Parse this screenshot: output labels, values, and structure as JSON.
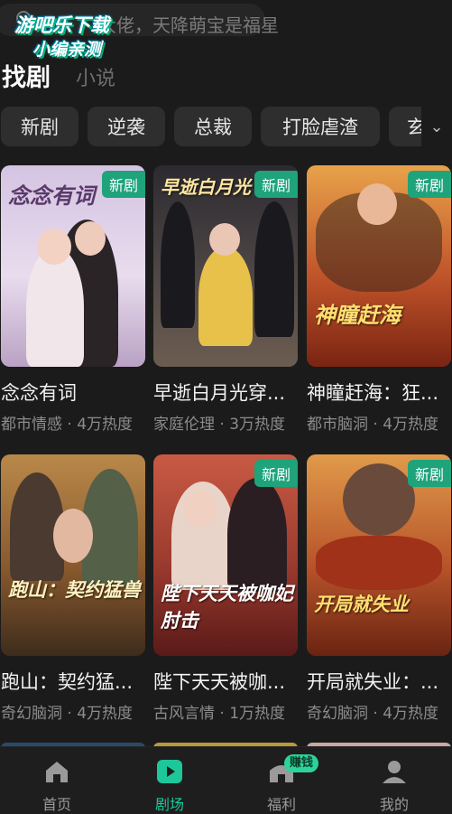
{
  "search": {
    "text": "大佬，天降萌宝是福星"
  },
  "watermark": {
    "line1": "游吧乐下载",
    "line2": "小编亲测"
  },
  "tabs": [
    {
      "label": "找剧",
      "active": true
    },
    {
      "label": "小说",
      "active": false
    }
  ],
  "chips": [
    "新剧",
    "逆袭",
    "总裁",
    "打脸虐渣",
    "玄"
  ],
  "badge_label": "新剧",
  "accent_color": "#1ea37a",
  "dramas": [
    {
      "poster_title": "念念有词",
      "title": "念念有词",
      "meta": "都市情感 · 4万热度",
      "badge": true,
      "bg": [
        "#c9b6d8",
        "#e6d6ea"
      ]
    },
    {
      "poster_title": "早逝白月光",
      "title": "早逝白月光穿...",
      "meta": "家庭伦理 · 3万热度",
      "badge": true,
      "bg": [
        "#3c3c46",
        "#6a6058"
      ]
    },
    {
      "poster_title": "神瞳赶海",
      "title": "神瞳赶海：狂...",
      "meta": "都市脑洞 · 4万热度",
      "badge": true,
      "bg": [
        "#d87a2a",
        "#8a2a14"
      ]
    },
    {
      "poster_title": "跑山：契约猛兽",
      "title": "跑山：契约猛...",
      "meta": "奇幻脑洞 · 4万热度",
      "badge": false,
      "bg": [
        "#8a5a2a",
        "#4a3a24"
      ]
    },
    {
      "poster_title": "陛下天天被咖妃肘击",
      "title": "陛下天天被咖...",
      "meta": "古风言情 · 1万热度",
      "badge": true,
      "bg": [
        "#b84a3a",
        "#6a2020"
      ]
    },
    {
      "poster_title": "开局就失业",
      "title": "开局就失业：...",
      "meta": "奇幻脑洞 · 4万热度",
      "badge": true,
      "bg": [
        "#d8883a",
        "#7a3414"
      ]
    }
  ],
  "bottom_nav": [
    {
      "label": "首页",
      "icon": "home-icon",
      "active": false
    },
    {
      "label": "剧场",
      "icon": "play-icon",
      "active": true
    },
    {
      "label": "福利",
      "icon": "gift-house-icon",
      "active": false,
      "badge": "赚钱"
    },
    {
      "label": "我的",
      "icon": "profile-icon",
      "active": false
    }
  ]
}
